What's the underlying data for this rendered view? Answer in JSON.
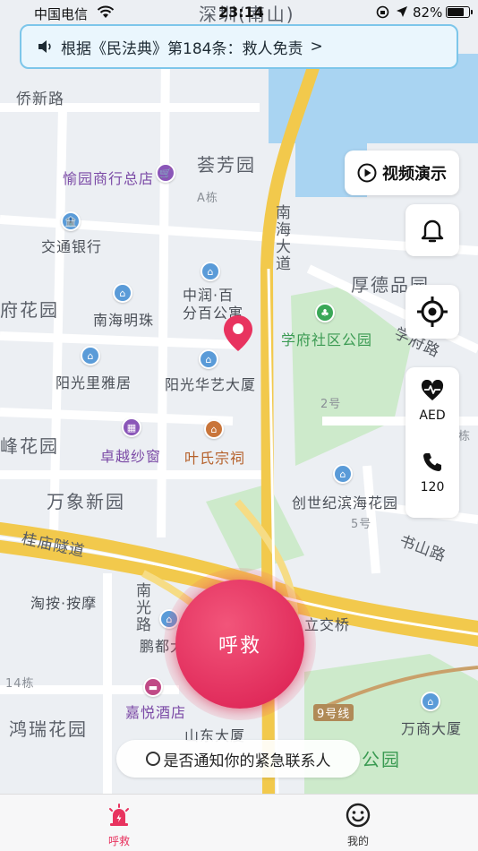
{
  "status_bar": {
    "carrier": "中国电信",
    "time": "23:14",
    "battery": "82%",
    "battery_level": 0.82
  },
  "law_banner": {
    "text": "根据《民法典》第184条：救人免责",
    "chevron": ">",
    "icon": "speaker-icon"
  },
  "map": {
    "labels": {
      "shenzhen_nanshan": "深圳(南山)",
      "qiaoxin_road": "侨新路",
      "yuyuan_store": "愉园商行总店",
      "quanfang_garden": "荟芳园",
      "a_building": "A栋",
      "bank_of_communications": "交通银行",
      "nanhai_avenue": "南海大道",
      "houde_pinyuan": "厚德品园",
      "zhongrun_department": "中润·百分百公寓",
      "nanhai_pearl": "南海明珠",
      "xuefu_park": "学府社区公园",
      "xuefu_road": "学府路",
      "yangguang_liya": "阳光里雅居",
      "yangguang_huayi": "阳光华艺大厦",
      "building_2": "2号",
      "zhuoyue_curtain": "卓越纱窗",
      "yeshi_temple": "叶氏宗祠",
      "wanxiang_garden": "万象新园",
      "chuangshiji_garden": "创世纪滨海花园",
      "building_5": "5号",
      "guimiao_tunnel": "桂庙隧道",
      "shushan_road": "书山路",
      "massage": "淘按·按摩",
      "nanguang_road": "南光路",
      "pengdu": "鹏都大",
      "interchange": "立交桥",
      "building_14": "14栋",
      "hongrui_garden": "鸿瑞花园",
      "jiayue_hotel": "嘉悦酒店",
      "shandong_building": "山东大厦",
      "line_9": "9号线",
      "wanshang_building": "万商大厦",
      "park_partial": "公园",
      "fuhua_garden": "府花园",
      "feng_garden": "峰花园",
      "building_a2": "栋"
    }
  },
  "controls": {
    "video_demo": "视频演示",
    "aed": "AED",
    "call_120": "120"
  },
  "sos": {
    "label": "呼救"
  },
  "notify": {
    "label": "是否通知你的紧急联系人",
    "checked": false
  },
  "tab_bar": {
    "tabs": [
      {
        "label": "呼救",
        "icon": "alarm-icon",
        "active": true
      },
      {
        "label": "我的",
        "icon": "smile-icon",
        "active": false
      }
    ]
  },
  "colors": {
    "accent": "#e8335f",
    "banner_border": "#7dc6ea",
    "main_road": "#f2c94c"
  }
}
